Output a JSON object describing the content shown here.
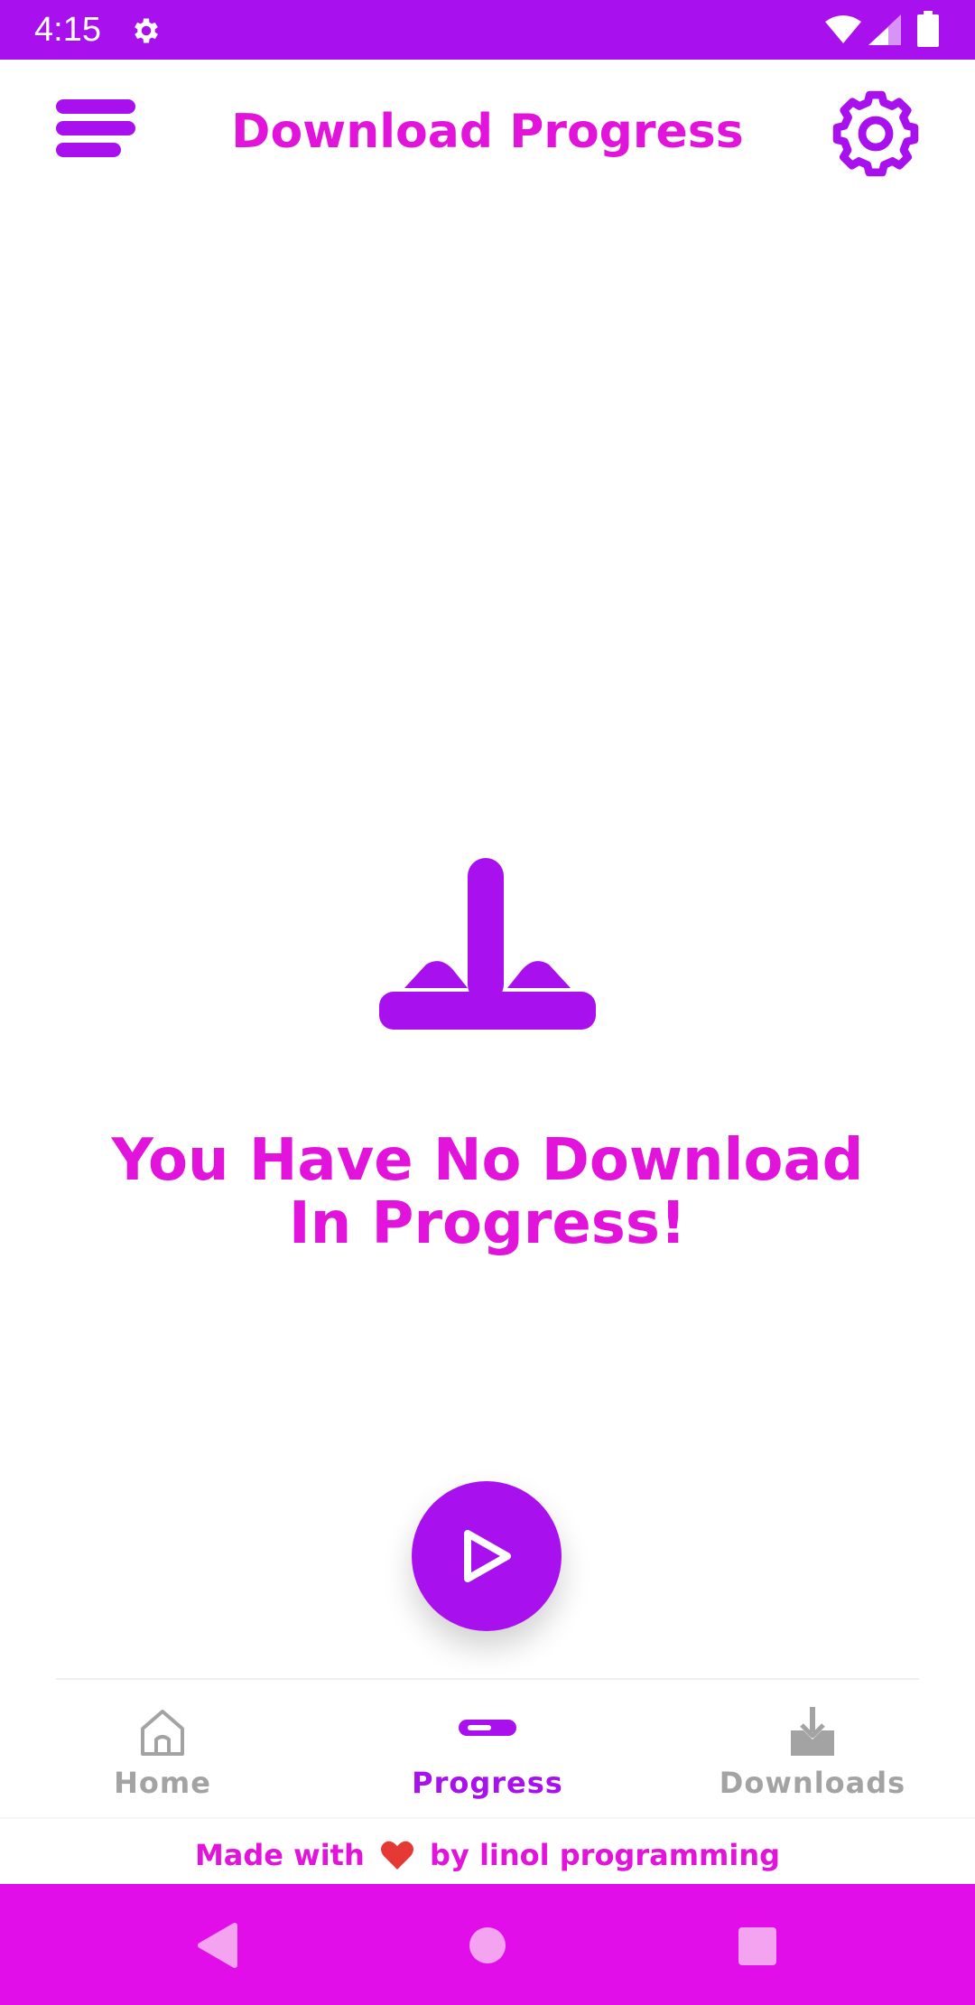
{
  "status_bar": {
    "time": "4:15",
    "icons": [
      "settings-icon",
      "wifi-icon",
      "signal-icon",
      "battery-icon"
    ]
  },
  "header": {
    "title": "Download Progress",
    "menu_icon": "menu-icon",
    "settings_icon": "gear-icon"
  },
  "empty_state": {
    "icon": "download-icon",
    "message": "You Have No Download In Progress!"
  },
  "fab": {
    "icon": "play-icon"
  },
  "bottom_nav": {
    "items": [
      {
        "label": "Home",
        "icon": "home-icon",
        "active": false
      },
      {
        "label": "Progress",
        "icon": "progress-icon",
        "active": true
      },
      {
        "label": "Downloads",
        "icon": "downloads-icon",
        "active": false
      }
    ]
  },
  "footer": {
    "prefix": "Made with",
    "heart": "heart-icon",
    "suffix": "by linol programming"
  },
  "system_nav": {
    "buttons": [
      "back-button",
      "home-button",
      "recents-button"
    ]
  },
  "colors": {
    "primary_purple": "#a810ee",
    "accent_magenta": "#e214dc",
    "system_nav_bg": "#e20ee9",
    "inactive_gray": "#a3a3a3"
  }
}
